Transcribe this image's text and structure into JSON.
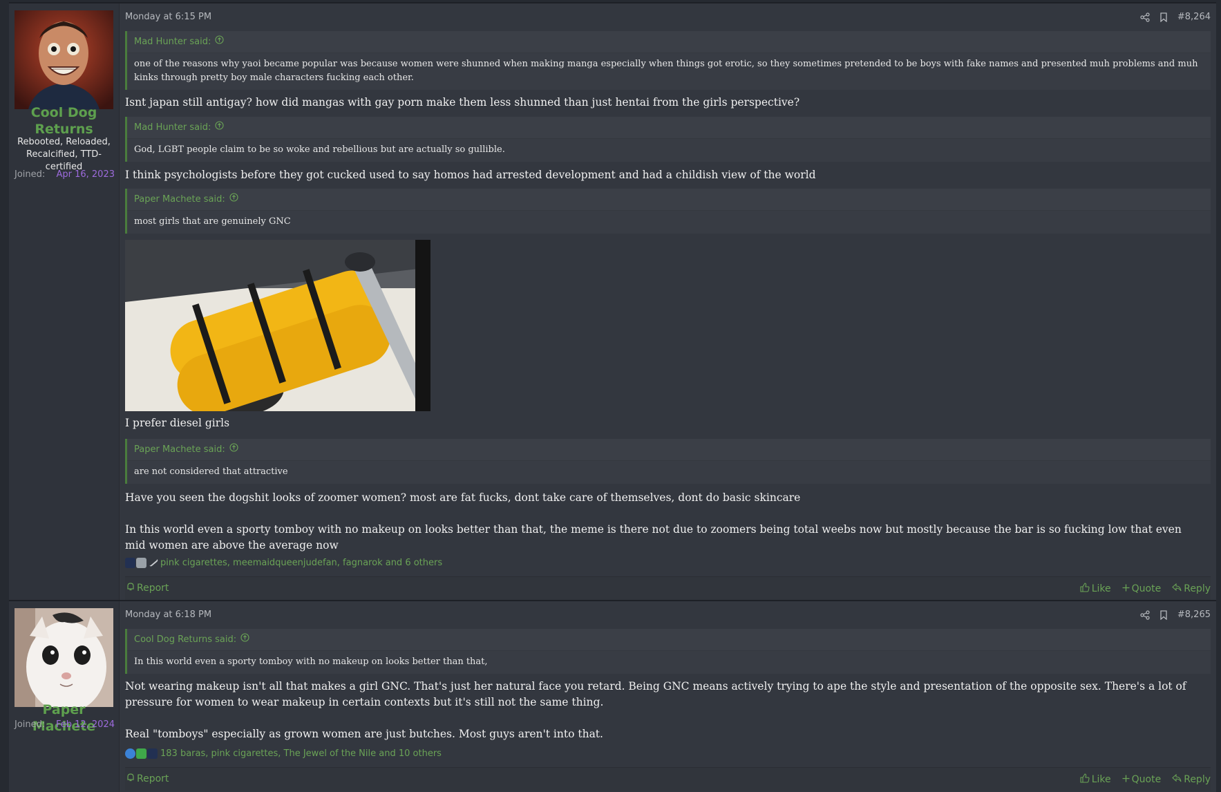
{
  "posts": [
    {
      "user": {
        "name": "Cool Dog Returns",
        "title": "Rebooted, Reloaded, Recalcified, TTD-certified",
        "joined_label": "Joined:",
        "joined_date": "Apr 16, 2023"
      },
      "date": "Monday at 6:15 PM",
      "post_number": "#8,264",
      "quotes": [
        {
          "author_said": "Mad Hunter said:",
          "text": "one of the reasons why yaoi became popular was because women were shunned when making manga especially when things got erotic, so they sometimes pretended to be boys with fake names and presented muh problems and muh kinks through pretty boy male characters fucking each other."
        },
        {
          "author_said": "Mad Hunter said:",
          "text": "God, LGBT people claim to be so woke and rebellious but are actually so gullible."
        },
        {
          "author_said": "Paper Machete said:",
          "text": "most girls that are genuinely GNC"
        },
        {
          "author_said": "Paper Machete said:",
          "text": "are not considered that attractive"
        }
      ],
      "replies": [
        "Isnt japan still antigay? how did mangas with gay porn make them less shunned than just hentai from the girls perspective?",
        "I think psychologists before they got cucked used to say homos had arrested development and had a childish view of the world",
        "I prefer diesel girls",
        "Have you seen the dogshit looks of zoomer women? most are fat fucks, dont take care of themselves, dont do basic skincare",
        "In this world even a sporty tomboy with no makeup on looks better than that, the meme is there not due to zoomers being total weebs now but mostly because the bar is so fucking low that even mid women are above the average now"
      ],
      "reactions_text": "pink cigarettes, meemaidqueenjudefan, fagnarok and 6 others",
      "actions": {
        "report": "Report",
        "like": "Like",
        "quote": "Quote",
        "reply": "Reply"
      }
    },
    {
      "user": {
        "name": "Paper Machete",
        "joined_label": "Joined:",
        "joined_date": "Feb 12, 2024"
      },
      "date": "Monday at 6:18 PM",
      "post_number": "#8,265",
      "quotes": [
        {
          "author_said": "Cool Dog Returns said:",
          "text": "In this world even a sporty tomboy with no makeup on looks better than that,"
        }
      ],
      "replies": [
        "Not wearing makeup isn't all that makes a girl GNC. That's just her natural face you retard. Being GNC means actively trying to ape the style and presentation of the opposite sex. There's a lot of pressure for women to wear makeup in certain contexts but it's still not the same thing.",
        "Real \"tomboys\" especially as grown women are just butches. Most guys aren't into that."
      ],
      "reactions_text": "183 baras, pink cigarettes, The Jewel of the Nile and 10 others",
      "actions": {
        "report": "Report",
        "like": "Like",
        "quote": "Quote",
        "reply": "Reply"
      }
    }
  ]
}
